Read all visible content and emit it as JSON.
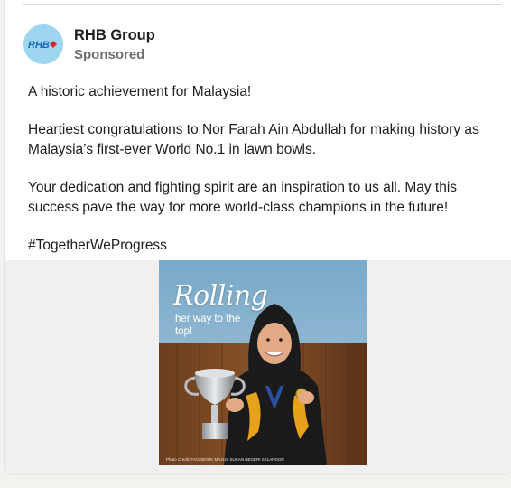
{
  "post": {
    "author": "RHB Group",
    "sponsored_label": "Sponsored",
    "logo_text": "RHB",
    "paragraphs": [
      "A historic achievement for Malaysia!",
      "Heartiest congratulations to Nor Farah Ain Abdullah for making history as Malaysia’s first-ever World No.1 in lawn bowls.",
      "Your dedication and fighting spirit are an inspiration to us all. May this success pave the way for more world-class champions in the future!"
    ],
    "hashtag": "#TogetherWeProgress"
  },
  "media": {
    "title": "Rolling",
    "subtitle": "her way to the top!",
    "credit": "Photo Credit: FACEBOOK MAJLIS SUKAN NEGERI SELANGOR"
  },
  "colors": {
    "logo_red": "#d6262c",
    "logo_blue": "#1667b6",
    "avatar_bg": "#9fd6ef"
  }
}
